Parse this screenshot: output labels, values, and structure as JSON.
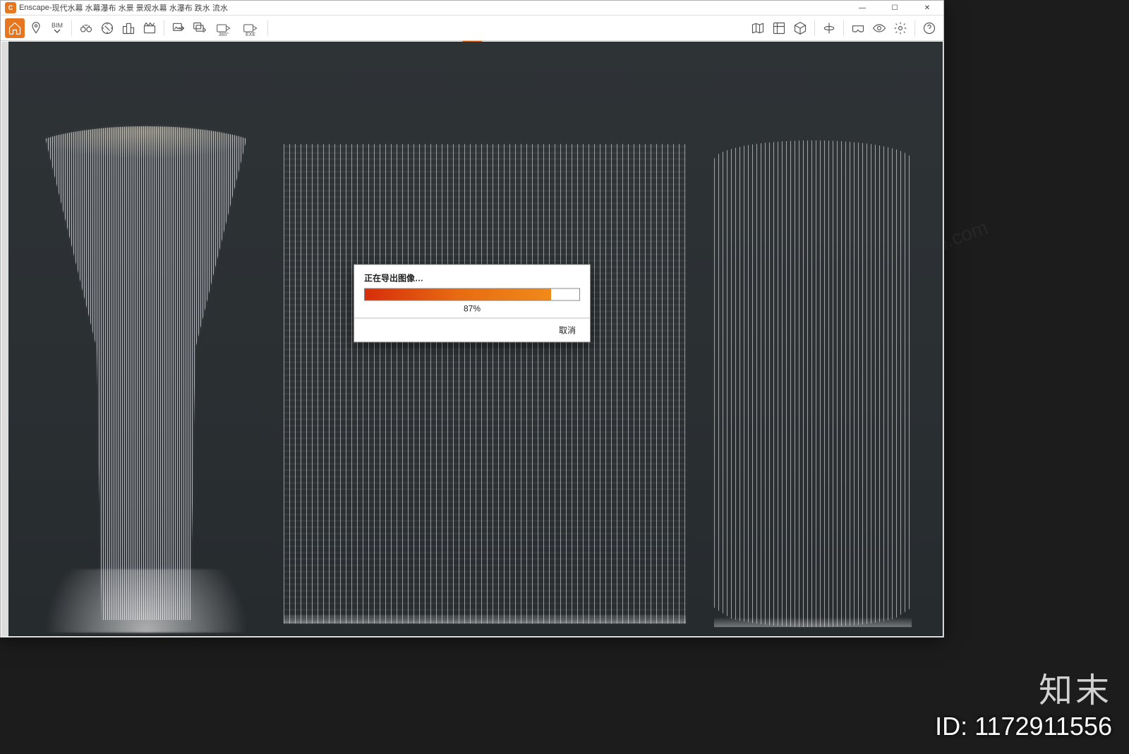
{
  "window": {
    "app_name": "Enscape",
    "separator": " - ",
    "document_title": "现代水幕 水幕瀑布 水景 景观水幕 水瀑布 跌水 流水",
    "app_icon_letter": "C"
  },
  "win_controls": {
    "min": "—",
    "max": "☐",
    "close": "✕"
  },
  "toolbar": {
    "bim_label": "BIM",
    "three_sixty": "360°",
    "exe_label": "EXE"
  },
  "dialog": {
    "title": "正在导出图像…",
    "percent_value": 87,
    "percent_text": "87%",
    "cancel_label": "取消"
  },
  "watermark": {
    "brand": "知末",
    "id_label": "ID: 1172911556",
    "diag": "znzmo.com"
  }
}
